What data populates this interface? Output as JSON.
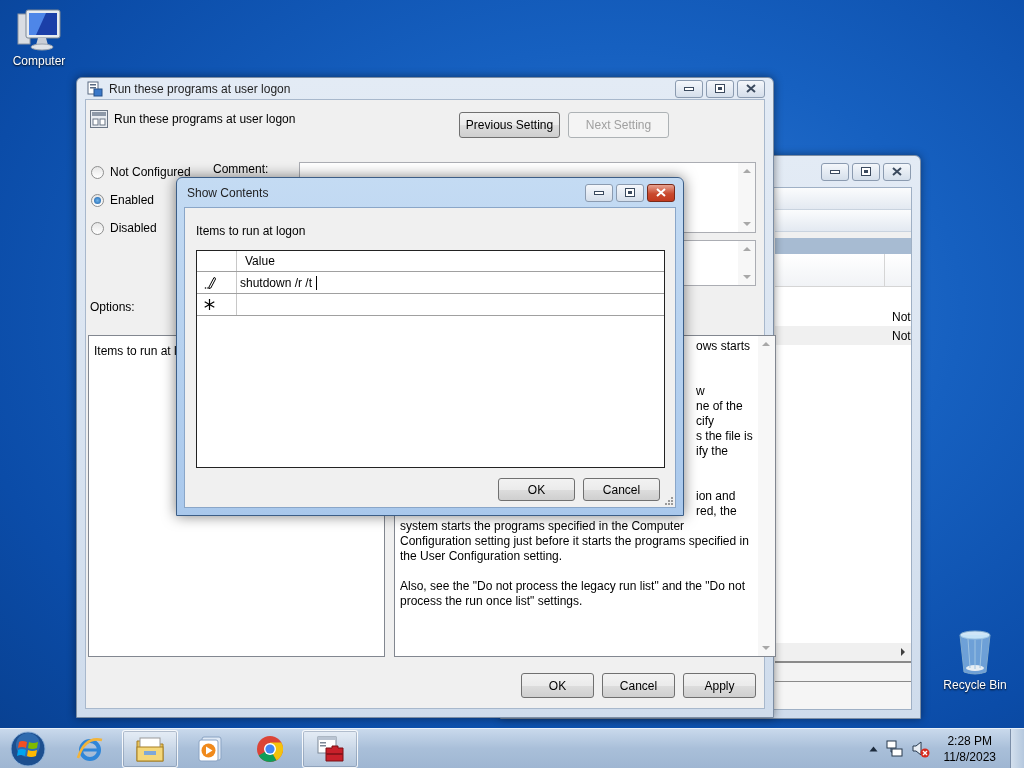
{
  "desktop_icons": [
    {
      "kind": "computer",
      "label": "Computer"
    },
    {
      "kind": "recycle-bin",
      "label": "Recycle Bin"
    }
  ],
  "background_window": {
    "active": false,
    "column_3_cells": [
      "Not",
      "Not"
    ]
  },
  "main_window": {
    "active": false,
    "title": "Run these programs at user logon",
    "setting_name": "Run these programs at user logon",
    "nav_buttons": [
      {
        "label": "Previous Setting",
        "disabled": false
      },
      {
        "label": "Next Setting",
        "disabled": true
      }
    ],
    "state_options": [
      {
        "label": "Not Configured",
        "selected": false
      },
      {
        "label": "Enabled",
        "selected": true
      },
      {
        "label": "Disabled",
        "selected": false
      }
    ],
    "comment_label": "Comment:",
    "options_label": "Options:",
    "options_text": "Items to run at l",
    "help_fragments": [
      [
        "ows starts"
      ],
      [
        "w",
        "ne of the",
        "cify",
        "s the file is",
        "ify the"
      ],
      [
        "ion and",
        "red, the"
      ]
    ],
    "help_paragraphs": [
      "system starts the programs specified in the Computer Configuration setting just before it starts the programs specified in the User Configuration setting.",
      "Also, see the \"Do not process the legacy run list\" and the \"Do not process the run once list\" settings."
    ],
    "buttons": [
      "OK",
      "Cancel",
      "Apply"
    ]
  },
  "dialog": {
    "active": true,
    "title": "Show Contents",
    "label": "Items to run at logon",
    "column": "Value",
    "rows": [
      {
        "kind": "editing",
        "value": "shutdown /r /t"
      },
      {
        "kind": "new"
      }
    ],
    "buttons": [
      "OK",
      "Cancel"
    ]
  },
  "taskbar": {
    "apps": [
      {
        "kind": "ie",
        "highlighted": false
      },
      {
        "kind": "explorer",
        "highlighted": true
      },
      {
        "kind": "media",
        "highlighted": false
      },
      {
        "kind": "chrome",
        "highlighted": false
      },
      {
        "kind": "toolbox",
        "highlighted": true
      }
    ],
    "time": "2:28 PM",
    "date": "11/8/2023"
  }
}
